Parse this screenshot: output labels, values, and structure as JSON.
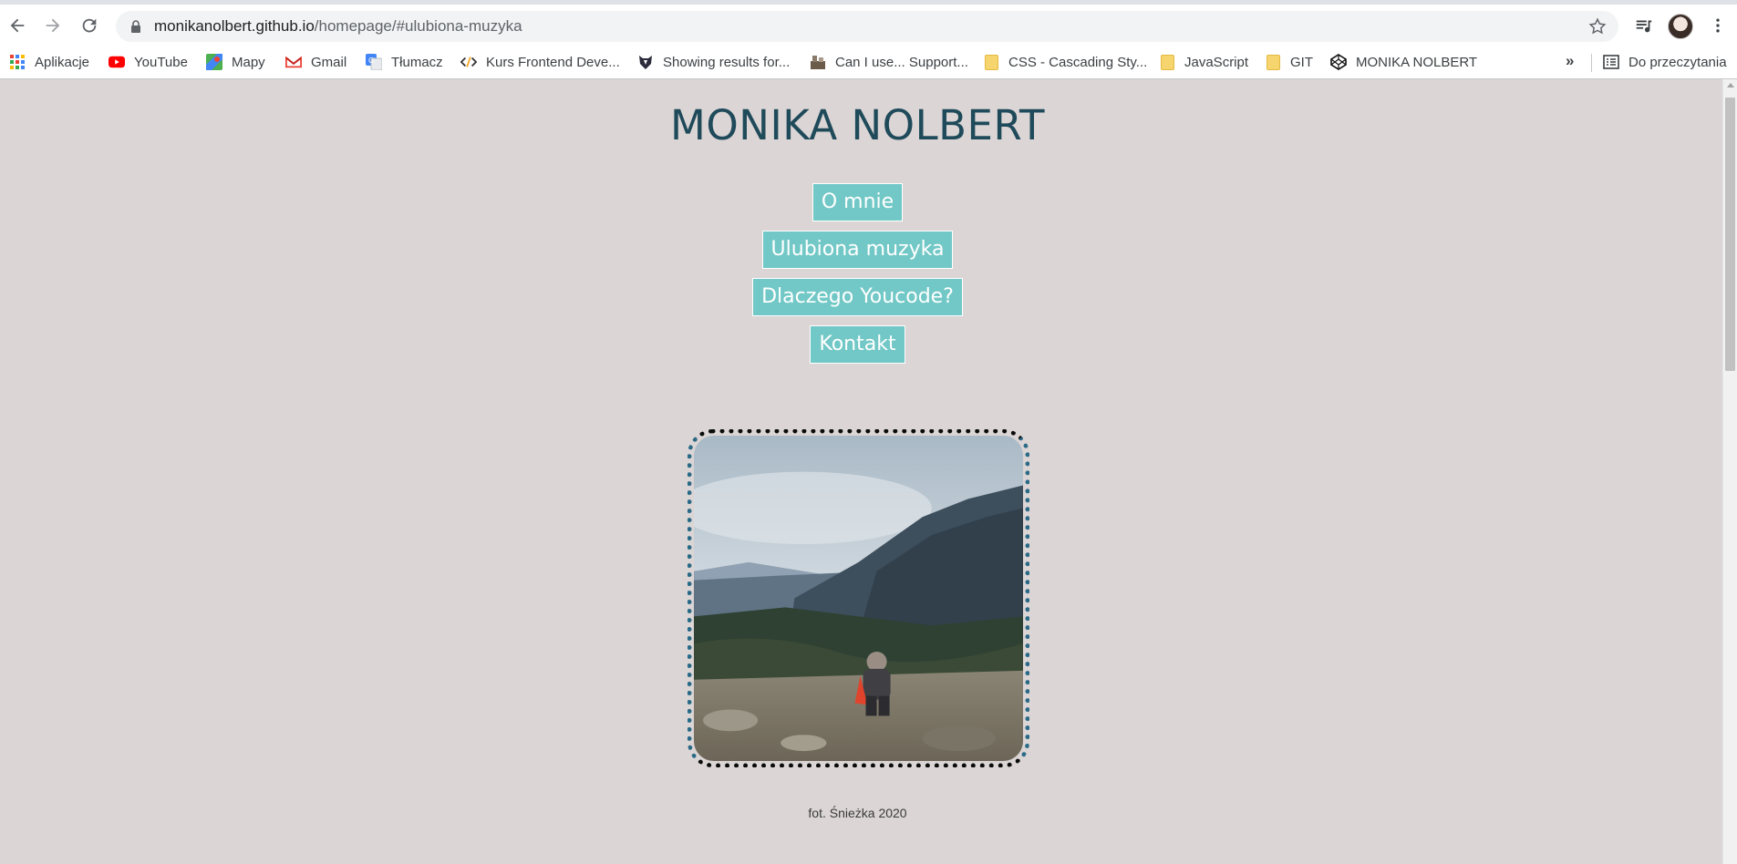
{
  "browser": {
    "url_host": "monikanolbert.github.io",
    "url_path": "/homepage/#ulubiona-muzyka",
    "bookmarks": [
      {
        "label": "Aplikacje",
        "icon": "apps-grid-icon"
      },
      {
        "label": "YouTube",
        "icon": "youtube-icon"
      },
      {
        "label": "Mapy",
        "icon": "maps-icon"
      },
      {
        "label": "Gmail",
        "icon": "gmail-icon"
      },
      {
        "label": "Tłumacz",
        "icon": "translate-icon"
      },
      {
        "label": "Kurs Frontend Deve...",
        "icon": "code-icon"
      },
      {
        "label": "Showing results for...",
        "icon": "badger-icon"
      },
      {
        "label": "Can I use... Support...",
        "icon": "caniuse-icon"
      },
      {
        "label": "CSS - Cascading Sty...",
        "icon": "folder-icon"
      },
      {
        "label": "JavaScript",
        "icon": "folder-icon"
      },
      {
        "label": "GIT",
        "icon": "folder-icon"
      },
      {
        "label": "MONIKA NOLBERT",
        "icon": "codepen-icon"
      }
    ],
    "more_label": "»",
    "reading_list_label": "Do przeczytania"
  },
  "page": {
    "title": "MONIKA NOLBERT",
    "menu": [
      {
        "label": "O mnie"
      },
      {
        "label": "Ulubiona muzyka"
      },
      {
        "label": "Dlaczego Youcode?"
      },
      {
        "label": "Kontakt"
      }
    ],
    "photo_caption": "fot. Śnieżka 2020"
  },
  "colors": {
    "page_bg": "#dbd5d5",
    "title": "#1f4a5a",
    "menu_bg": "#72c8c6",
    "menu_text": "#ffffff"
  }
}
